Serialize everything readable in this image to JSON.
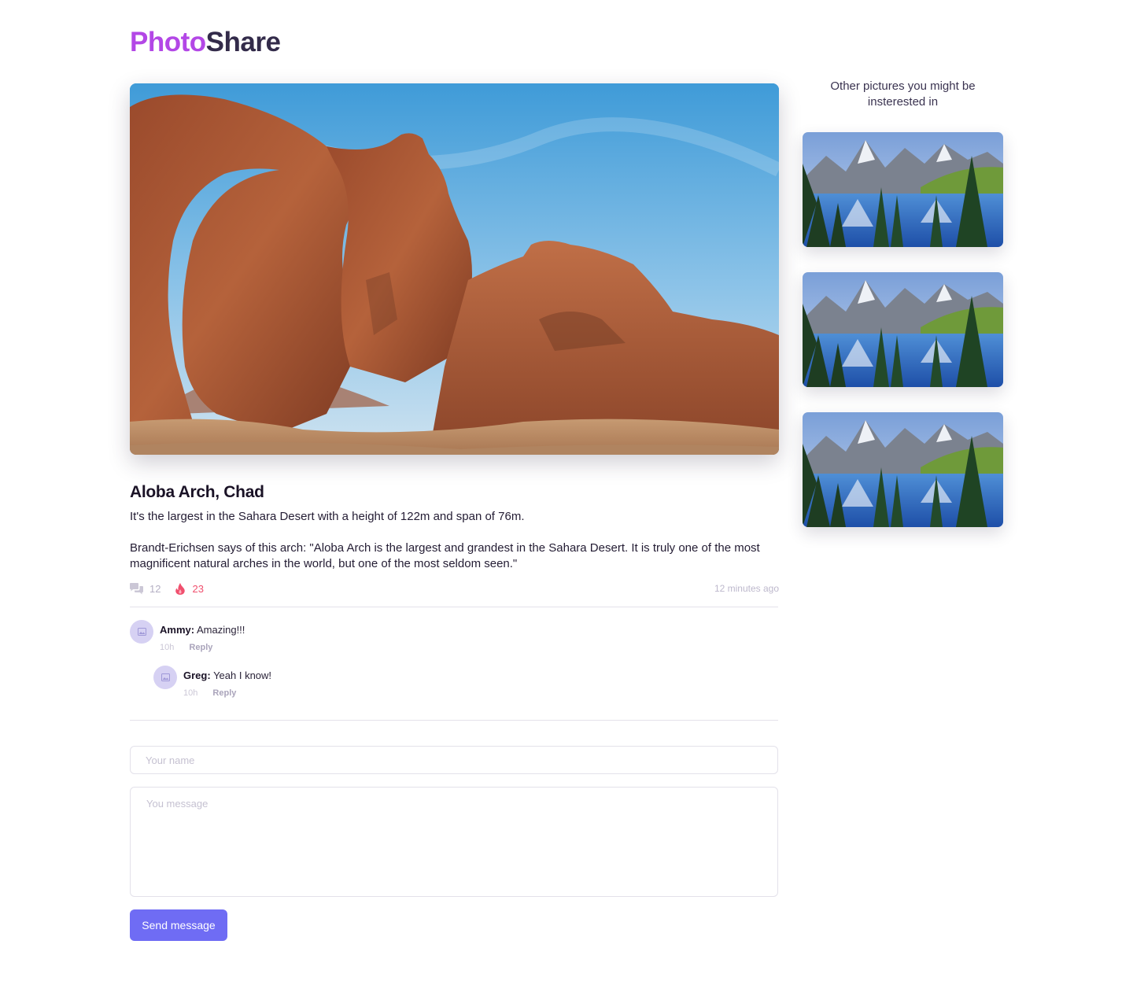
{
  "brand": {
    "part1": "Photo",
    "part2": "Share"
  },
  "post": {
    "image_alt": "Aloba Arch rock formation",
    "title": "Aloba Arch, Chad",
    "paragraph1": "It's the largest in the Sahara Desert with a height of 122m and span of 76m.",
    "paragraph2": "Brandt-Erichsen says of this arch: \"Aloba Arch is the largest and grandest in the Sahara Desert. It is truly one of the most magnificent natural arches in the world, but one of the most seldom seen.\"",
    "comments_count": "12",
    "likes_count": "23",
    "posted_time": "12 minutes ago"
  },
  "comments": [
    {
      "author": "Ammy:",
      "text": "Amazing!!!",
      "age": "10h",
      "reply_label": "Reply"
    },
    {
      "author": "Greg:",
      "text": "Yeah I know!",
      "age": "10h",
      "reply_label": "Reply"
    }
  ],
  "form": {
    "name_placeholder": "Your name",
    "message_placeholder": "You message",
    "send_label": "Send message"
  },
  "sidebar": {
    "title": "Other pictures you might be insterested in"
  },
  "colors": {
    "brand_purple": "#b347e6",
    "brand_dark": "#332b4a",
    "accent": "#6f6cf4",
    "like_red": "#f0506e"
  },
  "icons": {
    "comments": "comments-icon",
    "likes": "flame-icon",
    "avatar": "image-placeholder-icon"
  }
}
